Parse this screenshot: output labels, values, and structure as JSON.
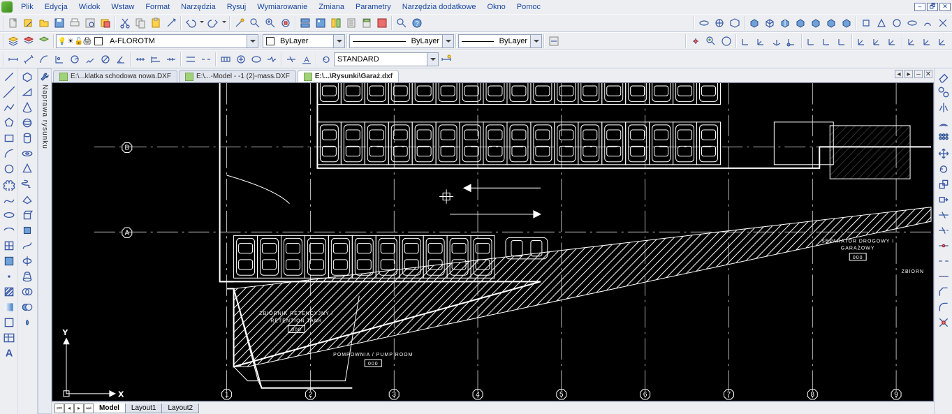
{
  "menu": {
    "items": [
      "Plik",
      "Edycja",
      "Widok",
      "Wstaw",
      "Format",
      "Narzędzia",
      "Rysuj",
      "Wymiarowanie",
      "Zmiana",
      "Parametry",
      "Narzędzia dodatkowe",
      "Okno",
      "Pomoc"
    ]
  },
  "window_controls": {
    "minimize": "–",
    "restore": "🗗",
    "close": "✕"
  },
  "layer": {
    "current": "A-FLOROTM",
    "color_combo": "ByLayer",
    "linetype_combo": "ByLayer",
    "lineweight_combo": "ByLayer"
  },
  "dimstyle": {
    "current": "STANDARD"
  },
  "doc_tabs": [
    {
      "label": "E:\\...klatka schodowa nowa.DXF",
      "active": false
    },
    {
      "label": "E:\\...-Model - -1 (2)-mass.DXF",
      "active": false
    },
    {
      "label": "E:\\...\\Rysunki\\Garaż.dxf",
      "active": true
    }
  ],
  "layout_tabs": {
    "items": [
      "Model",
      "Layout1",
      "Layout2"
    ],
    "active": "Model"
  },
  "side_panel": {
    "label": "Naprawa rysunku"
  },
  "drawing": {
    "grid_letters": [
      "A",
      "B"
    ],
    "grid_numbers": [
      "1",
      "2",
      "3",
      "4",
      "5",
      "6",
      "7",
      "8",
      "9"
    ],
    "labels": {
      "retention_l1": "ZBIORNIK RETENCYJNY /",
      "retention_l2": "RETENTION TANK",
      "retention_code": "000",
      "pump_l1": "POMPOWNIA / PUMP ROOM",
      "pump_code": "000",
      "separator_l1": "SEPARATOR DROGOWY I",
      "separator_l2": "GARAŻOWY",
      "separator_code": "000",
      "zbiorn": "ZBIORN"
    },
    "ucs": {
      "x": "X",
      "y": "Y"
    }
  },
  "colors": {
    "app_bg": "#eceef1",
    "canvas_bg": "#000000",
    "drawing": "#ffffff"
  }
}
